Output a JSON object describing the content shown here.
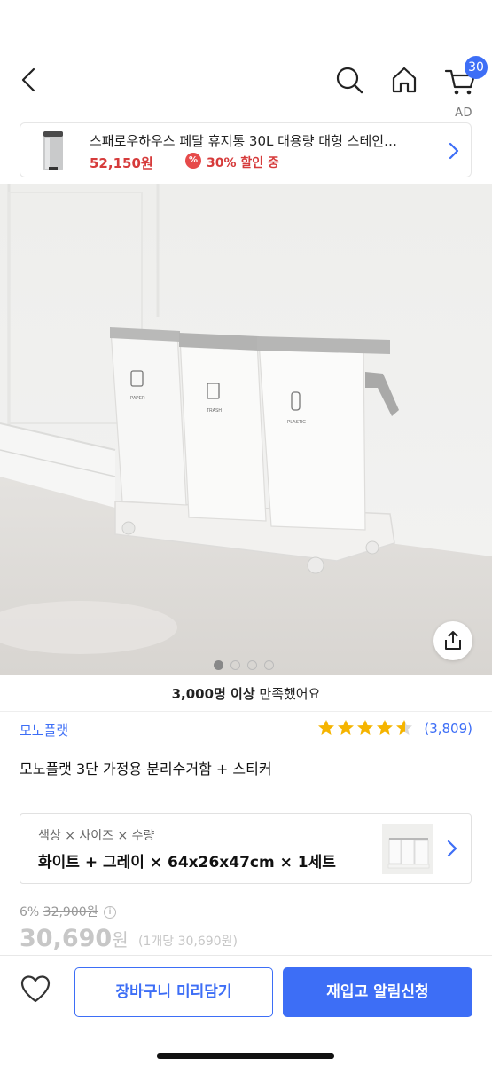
{
  "nav": {
    "cart_count": "30",
    "icons": [
      "back-icon",
      "search-icon",
      "home-icon",
      "cart-icon"
    ]
  },
  "ad": {
    "label": "AD",
    "title": "스패로우하우스 페달 휴지통 30L 대용량 대형 스테인…",
    "price": "52,150원",
    "sale_icon": "%",
    "discount": "30% 할인 중"
  },
  "hero": {
    "bin_labels": [
      "PAPER",
      "TRASH",
      "PLASTIC"
    ],
    "image_count": 4,
    "active_image": 1
  },
  "satisfaction": {
    "bold": "3,000명 이상",
    "rest": " 만족했어요"
  },
  "product": {
    "brand": "모노플랫",
    "rating": 4.5,
    "review_count": "(3,809)",
    "title": "모노플랫 3단 가정용 분리수거함 + 스티커"
  },
  "option": {
    "labels": "색상 × 사이즈 × 수량",
    "value": "화이트 + 그레이 × 64x26x47cm × 1세트"
  },
  "pricing": {
    "discount_rate": "6%",
    "original_price": "32,900원",
    "info_icon": "i",
    "price": "30,690",
    "price_unit": "원",
    "unit_price": "(1개당 30,690원)"
  },
  "bottom_bar": {
    "cart_button": "장바구니 미리담기",
    "restock_button": "재입고 알림신청"
  },
  "colors": {
    "accent": "#3d6ef6",
    "sale_red": "#d63b3b",
    "star": "#f5b400"
  }
}
